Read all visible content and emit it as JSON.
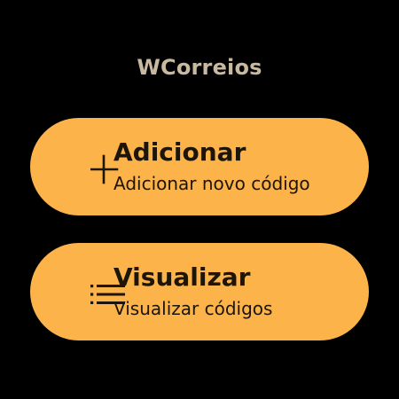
{
  "app": {
    "title": "WCorreios"
  },
  "colors": {
    "background": "#000000",
    "title": "#C8B9A0",
    "chip": "#FBB34A",
    "on_chip": "#1C1508"
  },
  "chips": [
    {
      "icon": "plus-icon",
      "label": "Adicionar",
      "secondary": "Adicionar novo código"
    },
    {
      "icon": "list-icon",
      "label": "Visualizar",
      "secondary": "Visualizar códigos"
    }
  ]
}
